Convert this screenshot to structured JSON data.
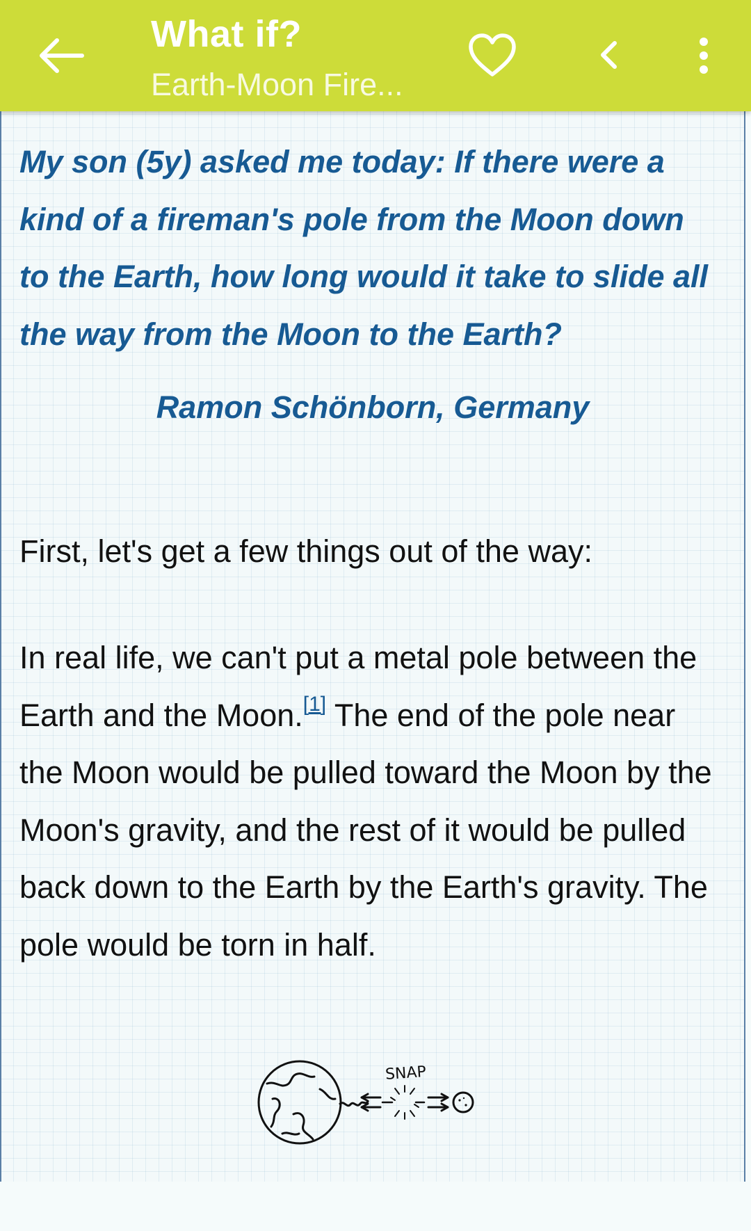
{
  "app_bar": {
    "title": "What if?",
    "subtitle": "Earth-Moon Fire...",
    "color": "#cddc39",
    "icons": [
      "arrow-back-icon",
      "heart-outline-icon",
      "chevron-left-icon",
      "more-vert-icon"
    ]
  },
  "article": {
    "question": "My son (5y) asked me today: If there were a kind of a fireman's pole from the Moon down to the Earth, how long would it take to slide all the way from the Moon to the Earth?",
    "attribution": "Ramon Schönborn, Germany",
    "paragraph1": "First, let's get a few things out of the way:",
    "paragraph2_before": "In real life, we can't put a metal pole between the Earth and the Moon.",
    "footnote": "[1]",
    "paragraph2_after": " The end of the pole near the Moon would be pulled toward the Moon by the Moon's gravity, and the rest of it would be pulled back down to the Earth by the Earth's gravity. The pole would be torn in half.",
    "figure_label": "SNAP",
    "accent_color": "#175a93"
  }
}
